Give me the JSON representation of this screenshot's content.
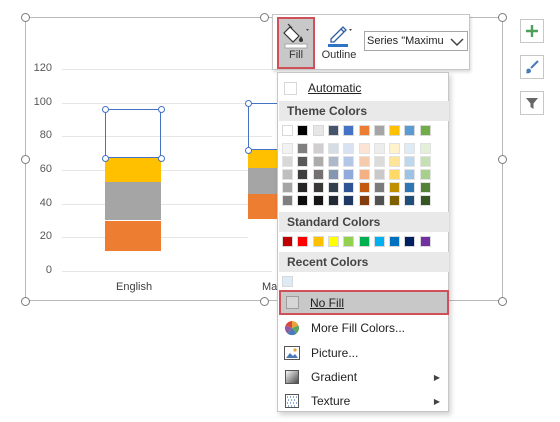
{
  "chart": {
    "y_ticks": [
      "120",
      "100",
      "80",
      "60",
      "40",
      "20",
      "0"
    ],
    "categories": [
      "English",
      "Ma"
    ]
  },
  "chart_data": {
    "type": "bar",
    "stacked": true,
    "categories": [
      "English",
      "Ma"
    ],
    "ylim": [
      0,
      120
    ],
    "series": [
      {
        "values": [
          12,
          31
        ],
        "color": "#ffffff"
      },
      {
        "values": [
          18,
          15
        ],
        "color": "#ed7d31"
      },
      {
        "values": [
          23,
          15
        ],
        "color": "#a5a5a5"
      },
      {
        "values": [
          14,
          11
        ],
        "color": "#ffc000"
      },
      {
        "values": [
          29,
          28
        ],
        "color": "none"
      }
    ]
  },
  "side_buttons": [
    {
      "icon": "plus-icon"
    },
    {
      "icon": "brush-icon"
    },
    {
      "icon": "filter-icon"
    }
  ],
  "toolbar": {
    "fill_label": "Fill",
    "outline_label": "Outline",
    "series_value": "Series \"Maximu"
  },
  "menu": {
    "automatic": "Automatic",
    "theme_colors_header": "Theme Colors",
    "standard_colors_header": "Standard Colors",
    "recent_colors_header": "Recent Colors",
    "no_fill": "No Fill",
    "more_fill_colors": "More Fill Colors...",
    "picture": "Picture...",
    "gradient": "Gradient",
    "texture": "Texture",
    "theme_top": [
      "#ffffff",
      "#000000",
      "#e7e6e6",
      "#44546a",
      "#4472c4",
      "#ed7d31",
      "#a5a5a5",
      "#ffc000",
      "#5b9bd5",
      "#70ad47"
    ],
    "theme_shades": [
      [
        "#f2f2f2",
        "#7f7f7f",
        "#d0cece",
        "#d6dce4",
        "#d9e2f3",
        "#fbe4d5",
        "#ededed",
        "#fff2cc",
        "#deebf6",
        "#e2efd9"
      ],
      [
        "#d8d8d8",
        "#595959",
        "#aeabab",
        "#adb9ca",
        "#b4c6e7",
        "#f7caac",
        "#dbdbdb",
        "#fee599",
        "#bdd7ee",
        "#c5e0b3"
      ],
      [
        "#bfbfbf",
        "#3f3f3f",
        "#757070",
        "#8496b0",
        "#8eaadb",
        "#f4b083",
        "#c9c9c9",
        "#ffd965",
        "#9cc3e5",
        "#a8d08d"
      ],
      [
        "#a5a5a5",
        "#262626",
        "#3a3838",
        "#323f4f",
        "#2f5496",
        "#c45911",
        "#7b7b7b",
        "#bf8f00",
        "#2e75b5",
        "#538135"
      ],
      [
        "#7f7f7f",
        "#0c0c0c",
        "#171616",
        "#222a35",
        "#1f3864",
        "#833c0b",
        "#525252",
        "#7f6000",
        "#1e4e79",
        "#375623"
      ]
    ],
    "standard": [
      "#c00000",
      "#ff0000",
      "#ffc000",
      "#ffff00",
      "#92d050",
      "#00b050",
      "#00b0f0",
      "#0070c0",
      "#002060",
      "#7030a0"
    ],
    "recent": [
      "#ddebf7"
    ]
  }
}
